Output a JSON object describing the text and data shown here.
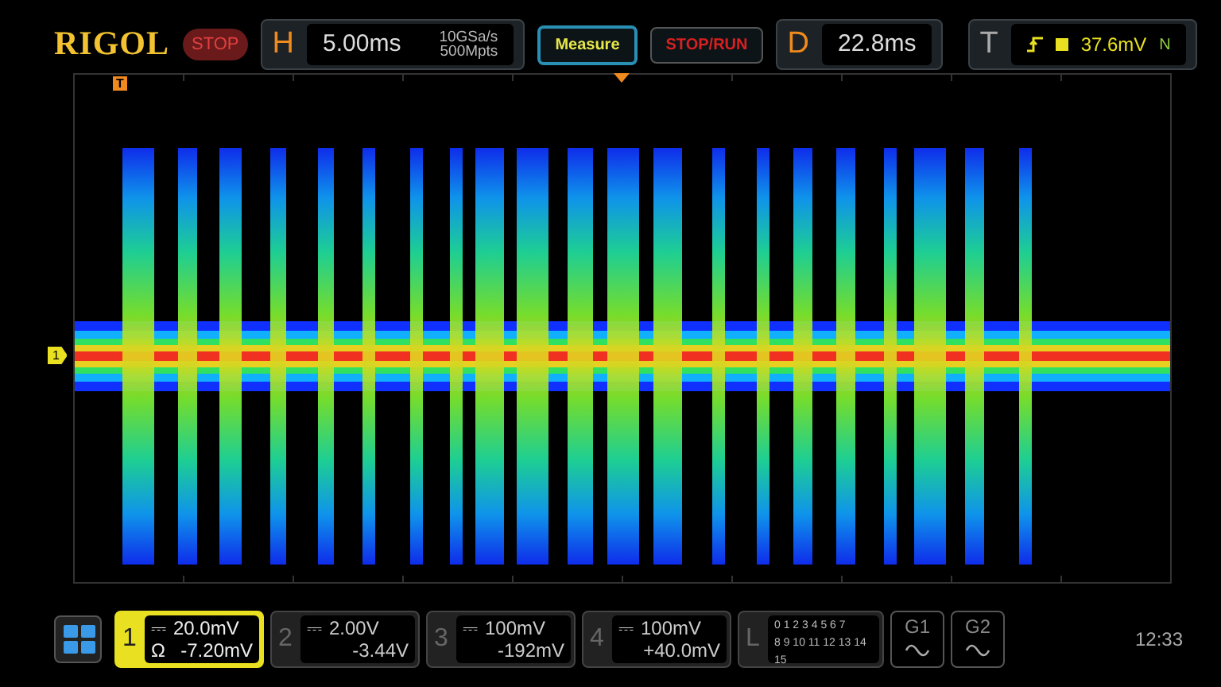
{
  "brand": "RIGOL",
  "run_state": "STOP",
  "horizontal": {
    "label": "H",
    "timebase": "5.00ms",
    "sample_rate": "10GSa/s",
    "memory": "500Mpts"
  },
  "buttons": [
    {
      "label": "Measure",
      "kind": "measure"
    },
    {
      "label": "STOP/RUN",
      "kind": "run"
    }
  ],
  "delay": {
    "label": "D",
    "value": "22.8ms"
  },
  "trigger": {
    "label": "T",
    "level": "37.6mV",
    "mode": "N"
  },
  "markers": {
    "trigger": "T",
    "channel": "1"
  },
  "channels": [
    {
      "number": "1",
      "coupling": "⎓",
      "scale": "20.0mV",
      "impedance": "Ω",
      "offset": "-7.20mV",
      "selected": true
    },
    {
      "number": "2",
      "coupling": "⎓",
      "scale": "2.00V",
      "offset": "-3.44V",
      "selected": false
    },
    {
      "number": "3",
      "coupling": "⎓",
      "scale": "100mV",
      "offset": "-192mV",
      "selected": false
    },
    {
      "number": "4",
      "coupling": "⎓",
      "scale": "100mV",
      "offset": "+40.0mV",
      "selected": false
    }
  ],
  "logic": {
    "label": "L",
    "row_1": "0 1 2 3 4 5 6 7",
    "row_2": "8 9 10 11 12 13 14 15"
  },
  "generators": [
    "G1",
    "G2"
  ],
  "time": "12:33"
}
